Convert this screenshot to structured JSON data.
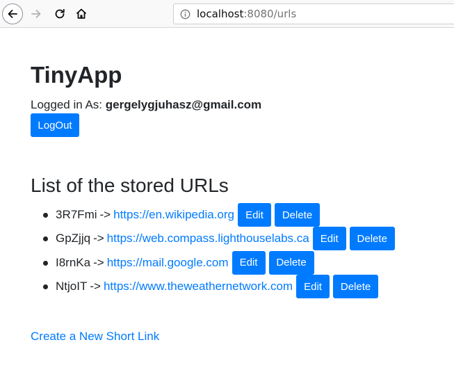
{
  "browser": {
    "url_host": "localhost",
    "url_rest": ":8080/urls"
  },
  "page": {
    "title": "TinyApp",
    "logged_in_label": "Logged in As:",
    "user_email": "gergelygjuhasz@gmail.com",
    "logout_label": "LogOut",
    "section_title": "List of the stored URLs",
    "arrow": "->",
    "edit_label": "Edit",
    "delete_label": "Delete",
    "urls": [
      {
        "short": "3R7Fmi",
        "long": "https://en.wikipedia.org"
      },
      {
        "short": "GpZjjq",
        "long": "https://web.compass.lighthouselabs.ca"
      },
      {
        "short": "I8rnKa",
        "long": "https://mail.google.com"
      },
      {
        "short": "NtjoIT",
        "long": "https://www.theweathernetwork.com"
      }
    ],
    "create_link_label": "Create a New Short Link"
  },
  "colors": {
    "primary": "#007bff",
    "text": "#212529"
  }
}
